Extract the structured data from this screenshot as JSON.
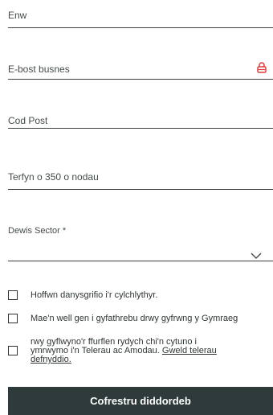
{
  "form": {
    "name_label": "Enw",
    "email_label": "E-bost busnes",
    "postcode_label": "Cod Post",
    "message_label": "Terfyn o 350 o nodau",
    "sector_label": "Dewis Sector *",
    "newsletter_label": "Hoffwn danysgrifio i'r cylchlythyr.",
    "welsh_label": "Mae'n well gen i gyfathrebu drwy gyfrwng y Gymraeg",
    "terms_line1": "rwy gyflwyno'r ffurflen rydych chi'n cytuno i",
    "terms_line2": "ymrwymo i'n Telerau ac Amodau.",
    "terms_link_part1": "Gweld telerau",
    "terms_link_part2": "defnyddio.",
    "submit_label": "Cofrestru diddordeb"
  },
  "icons": {
    "lock": "lock-icon",
    "dropdown": "chevron-down-icon"
  },
  "colors": {
    "lock": "#e03a3a",
    "button_bg": "#2f3a3a",
    "button_text": "#ffffff",
    "line": "#3a3f3f"
  }
}
